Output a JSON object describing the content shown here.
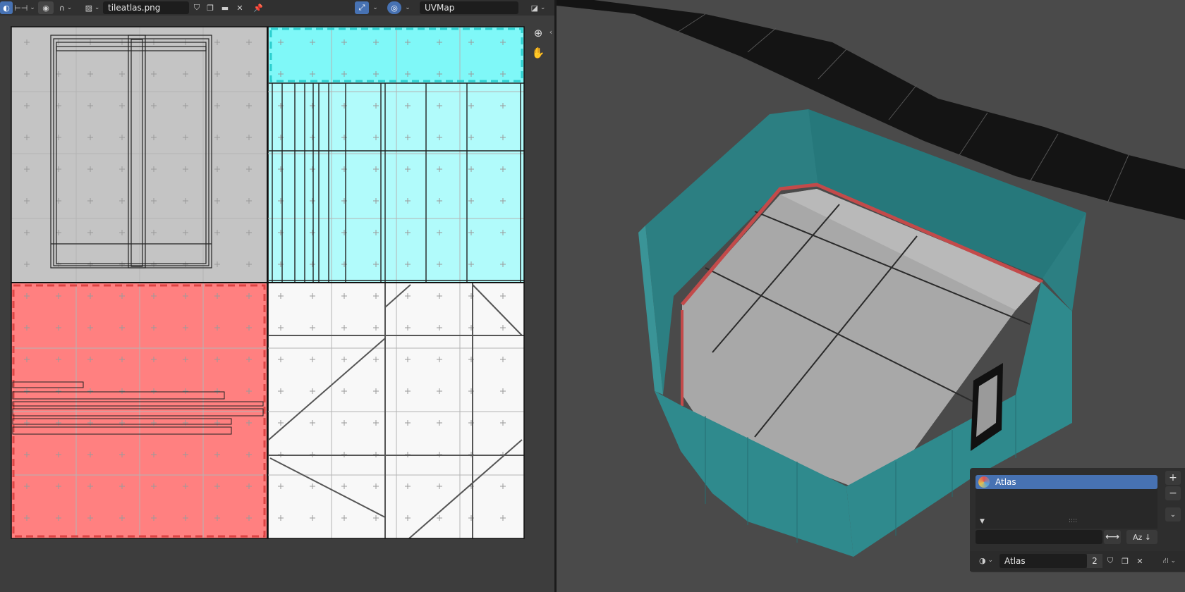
{
  "uv_header": {
    "image_name": "tileatlas.png",
    "uv_map": "UVMap"
  },
  "material_panel": {
    "slots": [
      {
        "name": "Atlas"
      }
    ],
    "filter_placeholder": "",
    "material_name": "Atlas",
    "user_count": "2"
  },
  "colors": {
    "uv_gray": "#c4c4c4",
    "uv_cyan": "#7ff8f8",
    "uv_cyan_light": "#b1fbfb",
    "uv_red": "#ff8080",
    "uv_white": "#f8f8f8",
    "wall_teal": "#2f8a8d",
    "floor_gray": "#a8a8a8",
    "accent_blue": "#4772b3"
  },
  "icons": [
    "editor-type-icon",
    "view-icon",
    "image-icon",
    "shield-icon",
    "duplicate-icon",
    "folder-icon",
    "close-icon",
    "pin-icon",
    "uv-sync-icon",
    "select-mode-icon",
    "overlay-icon",
    "zoom-icon",
    "hand-icon",
    "sphere-icon",
    "sort-icon",
    "node-tree-icon"
  ]
}
